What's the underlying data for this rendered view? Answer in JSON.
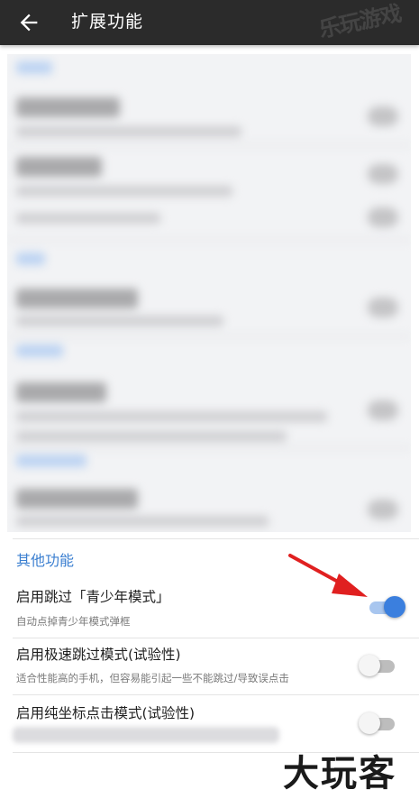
{
  "appbar": {
    "title": "扩展功能",
    "back_icon": "arrow-left-icon",
    "watermark": "乐玩游戏"
  },
  "section": {
    "label": "其他功能"
  },
  "settings": [
    {
      "title": "启用跳过「青少年模式」",
      "subtitle": "自动点掉青少年模式弹框",
      "enabled": true
    },
    {
      "title": "启用极速跳过模式(试验性)",
      "subtitle": "适合性能高的手机，但容易能引起一些不能跳过/导致误点击",
      "enabled": false
    },
    {
      "title": "启用纯坐标点击模式(试验性)",
      "subtitle": "",
      "enabled": false
    }
  ],
  "watermark": "大玩客",
  "colors": {
    "appbar": "#2b2b2b",
    "accent": "#3b7fde",
    "section_label": "#3b7fd0",
    "annotation_arrow": "#e02020"
  }
}
